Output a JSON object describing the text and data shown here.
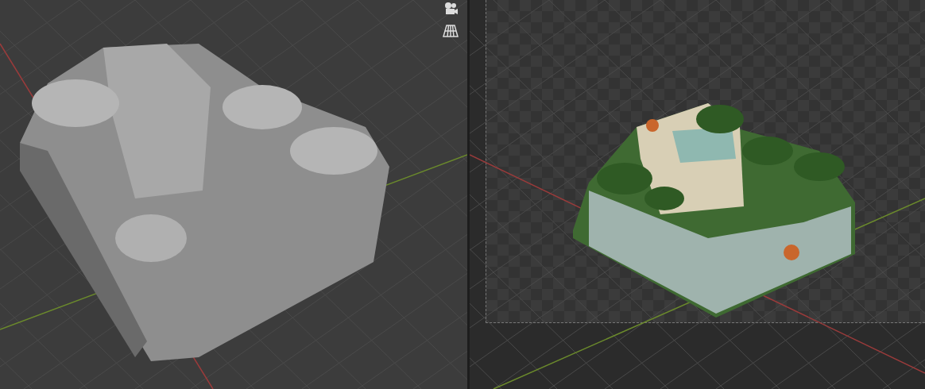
{
  "viewports": [
    {
      "kind": "solid_shading"
    },
    {
      "kind": "rendered_preview"
    }
  ]
}
